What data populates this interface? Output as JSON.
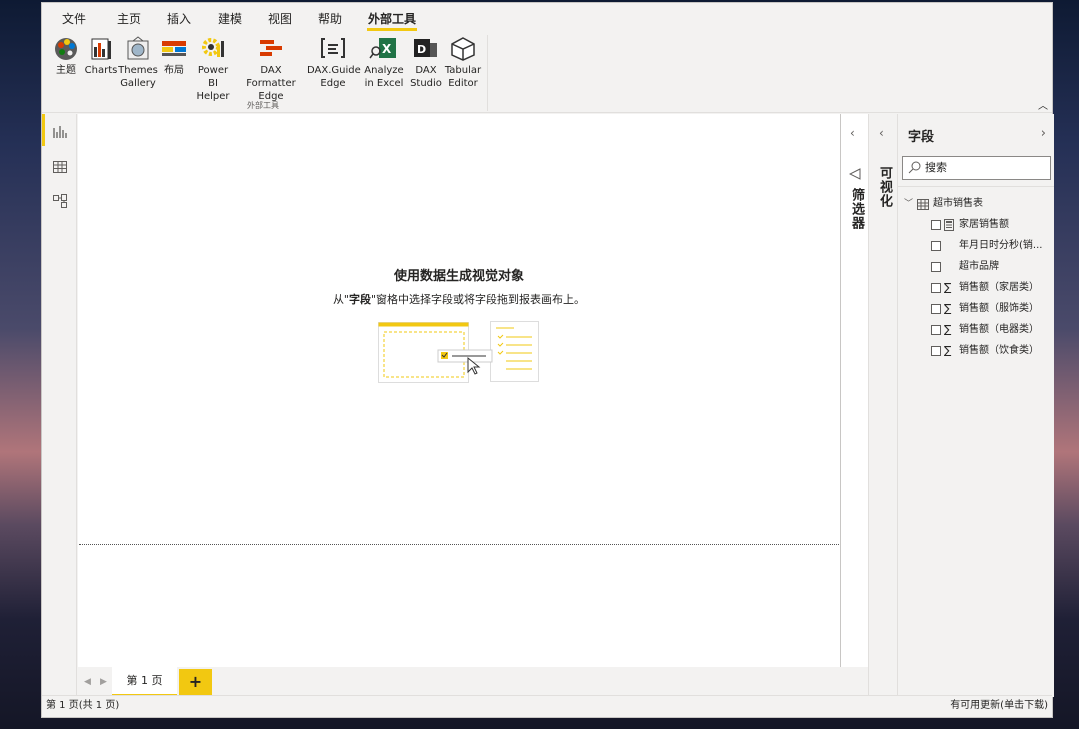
{
  "menu_tabs": [
    "文件",
    "主页",
    "插入",
    "建模",
    "视图",
    "帮助",
    "外部工具"
  ],
  "active_tab": "外部工具",
  "ribbon": {
    "buttons": [
      {
        "label": "主题",
        "icon": "theme-palette-icon"
      },
      {
        "label": "Charts",
        "icon": "charts-icon"
      },
      {
        "label": "Themes Gallery",
        "icon": "themes-gallery-icon"
      },
      {
        "label": "布局",
        "icon": "layout-icon"
      },
      {
        "label": "Power BI Helper",
        "icon": "gear-chart-icon"
      },
      {
        "label": "DAX Formatter Edge",
        "icon": "dax-formatter-icon"
      },
      {
        "label": "DAX.Guide Edge",
        "icon": "dax-guide-icon"
      },
      {
        "label": "Analyze in Excel",
        "icon": "excel-icon"
      },
      {
        "label": "DAX Studio",
        "icon": "dax-studio-icon"
      },
      {
        "label": "Tabular Editor",
        "icon": "tabular-editor-icon"
      }
    ],
    "group_label": "外部工具"
  },
  "canvas": {
    "empty_title": "使用数据生成视觉对象",
    "empty_sub_prefix": "从\"",
    "empty_sub_bold": "字段",
    "empty_sub_suffix": "\"窗格中选择字段或将字段拖到报表画布上。"
  },
  "pages": {
    "tab_label": "第 1 页",
    "add_label": "+"
  },
  "filter_pane": {
    "label": "筛选器"
  },
  "viz_pane": {
    "label": "可视化"
  },
  "fields_pane": {
    "title": "字段",
    "search_placeholder": "搜索",
    "table_name": "超市销售表",
    "fields": [
      {
        "name": "家居销售额",
        "type": "calc"
      },
      {
        "name": "年月日时分秒(销...",
        "type": "text"
      },
      {
        "name": "超市品牌",
        "type": "text"
      },
      {
        "name": "销售额（家居类）",
        "type": "sum"
      },
      {
        "name": "销售额（服饰类）",
        "type": "sum"
      },
      {
        "name": "销售额（电器类）",
        "type": "sum"
      },
      {
        "name": "销售额（饮食类）",
        "type": "sum"
      }
    ]
  },
  "status": {
    "left": "第 1 页(共 1 页)",
    "right": "有可用更新(单击下载)"
  },
  "colors": {
    "accent": "#f2c811",
    "excel_green": "#217346",
    "orange_red": "#d83b01"
  }
}
